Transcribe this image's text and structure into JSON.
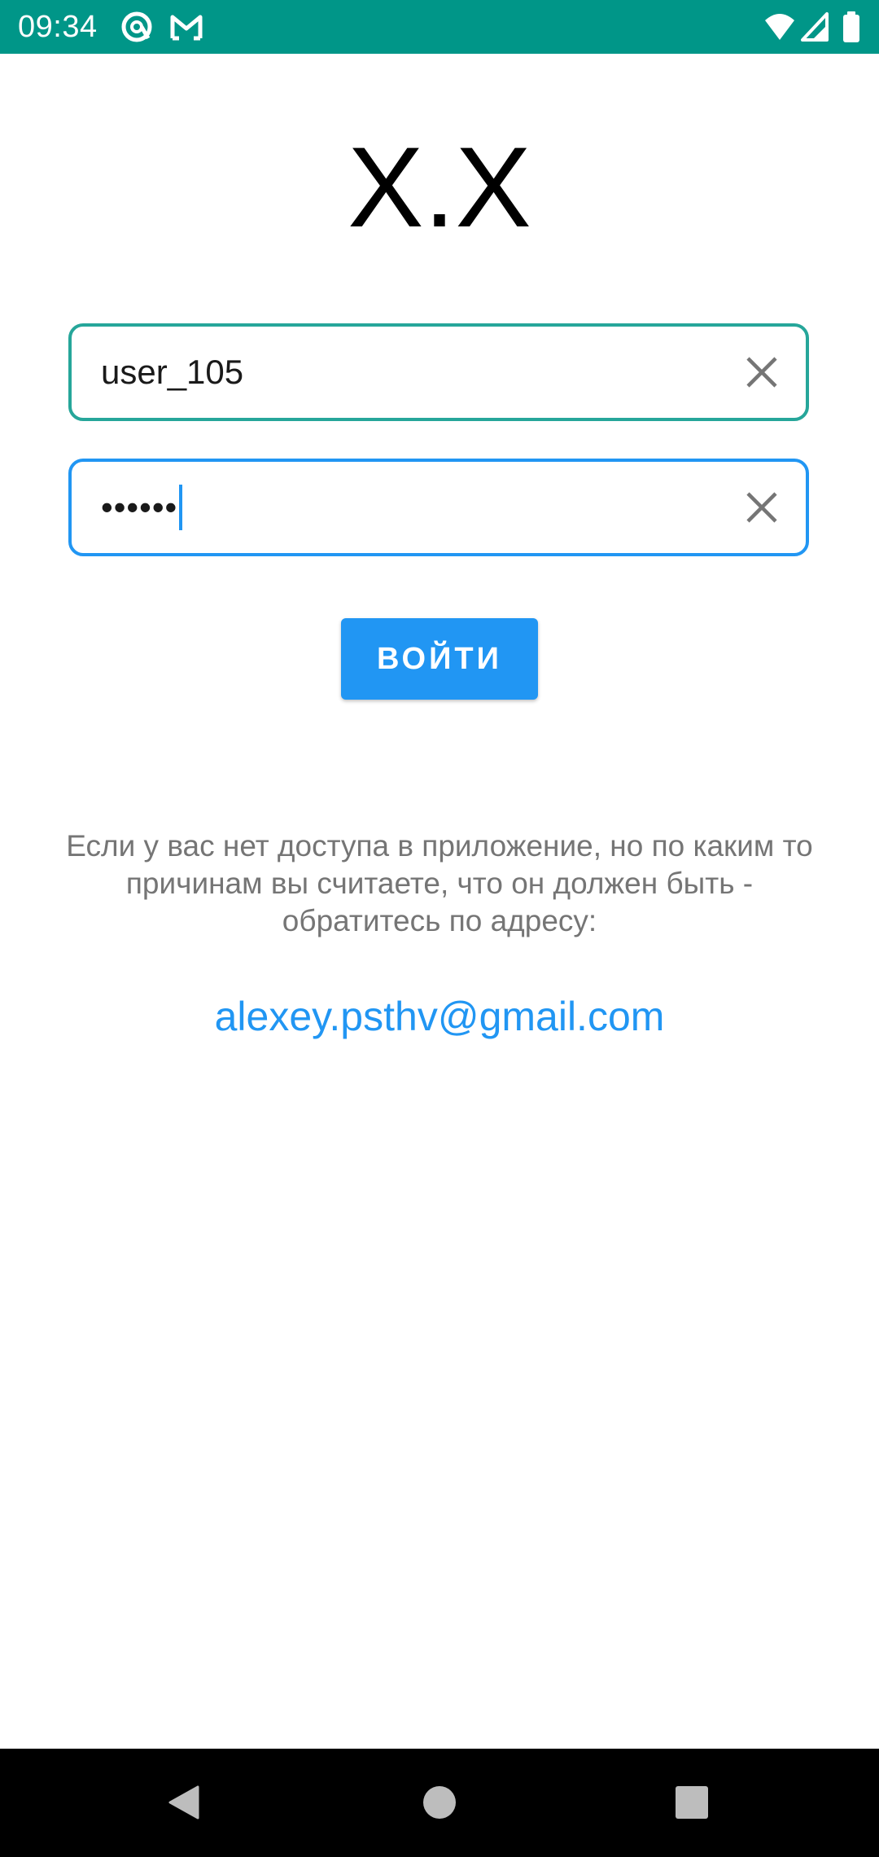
{
  "status_bar": {
    "time": "09:34",
    "background": "#009688",
    "left_icons": [
      "at-sign-notification-icon",
      "gmail-icon"
    ],
    "right_icons": [
      "wifi-icon",
      "signal-icon",
      "battery-icon"
    ]
  },
  "app": {
    "title": "X.X"
  },
  "login_form": {
    "username_value": "user_105",
    "password_value": "••••••",
    "username_border_color": "#26a69a",
    "password_border_color": "#2196f3",
    "clear_icon": "close-icon",
    "submit_label": "ВОЙТИ",
    "submit_color": "#2196f3"
  },
  "info": {
    "message": "Если у вас нет доступа в приложение, но по каким то причинам вы считаете, что он должен быть - обратитесь по адресу:",
    "email": "alexey.psthv@gmail.com",
    "email_color": "#2196f3"
  },
  "navigation_bar": {
    "buttons": [
      "back-icon",
      "home-icon",
      "recents-icon"
    ]
  }
}
